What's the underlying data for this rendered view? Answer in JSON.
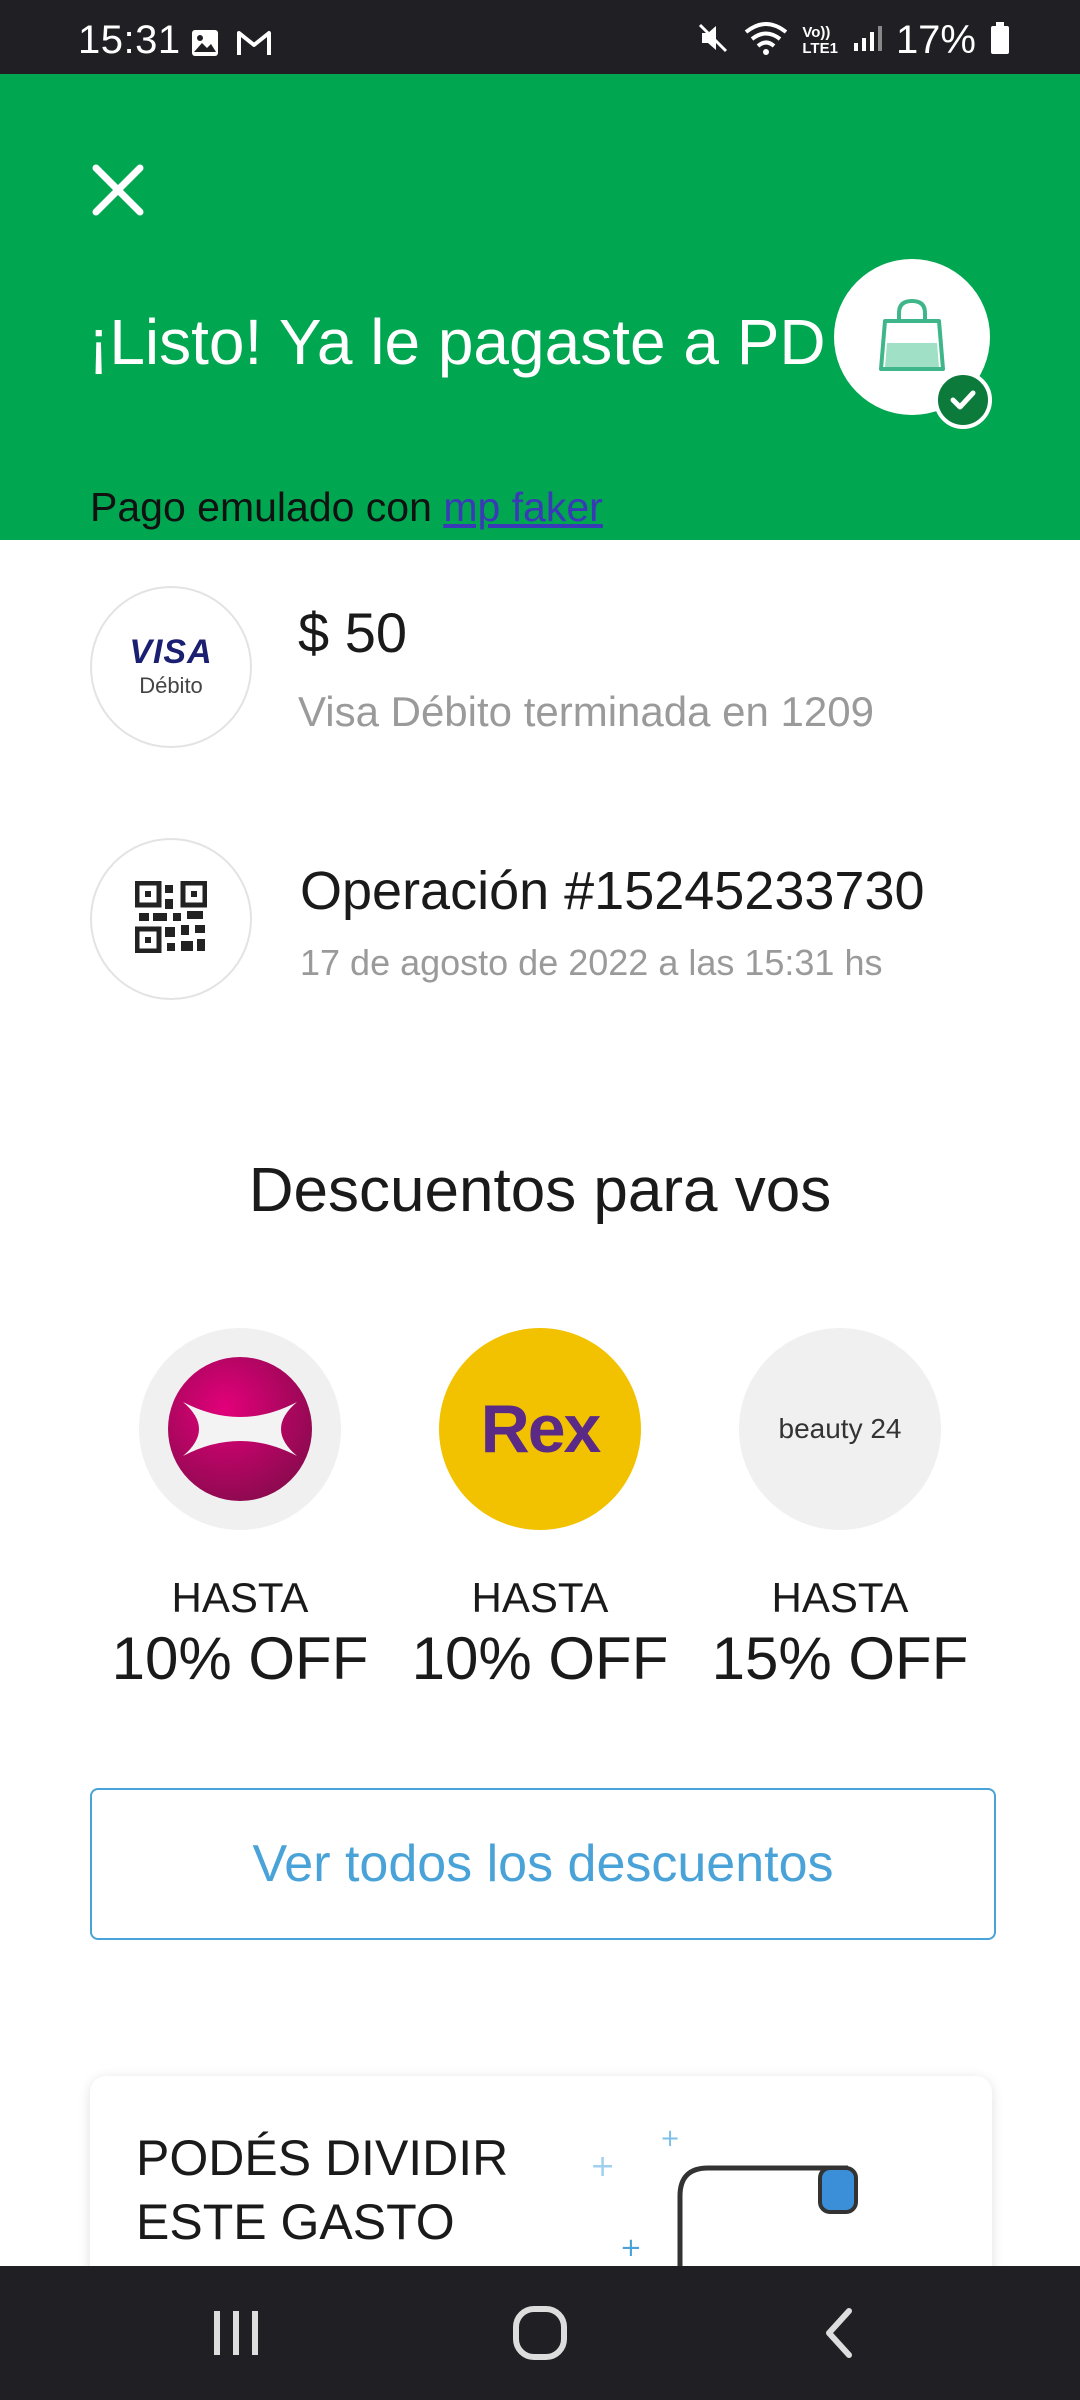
{
  "status_bar": {
    "time": "15:31",
    "battery": "17%",
    "left_icons": [
      "image-icon",
      "gmail-icon"
    ],
    "right_icons": [
      "mute-icon",
      "wifi-icon",
      "volte-icon",
      "signal-icon",
      "battery-icon"
    ],
    "volte_label_top": "Vo))",
    "volte_label_bottom": "LTE1"
  },
  "header": {
    "close_icon": "close-icon",
    "title": "¡Listo! Ya le pagaste a PD",
    "subtitle_prefix": "Pago emulado con ",
    "subtitle_link": "mp faker",
    "badge_icon": "shopping-bag-icon",
    "check_icon": "check-icon",
    "background_color": "#00a650"
  },
  "payment": {
    "card_brand": "VISA",
    "card_type": "Débito",
    "amount": "$ 50",
    "card_description": "Visa Débito terminada en 1209"
  },
  "operation": {
    "icon": "qr-code-icon",
    "title": "Operación #15245233730",
    "date": "17 de agosto de 2022 a las 15:31 hs"
  },
  "discounts": {
    "title": "Descuentos para vos",
    "items": [
      {
        "brand": "",
        "logo_icon": "x-brand-logo-icon",
        "label": "HASTA",
        "value": "10% OFF"
      },
      {
        "brand": "Rex",
        "logo_icon": "rex-logo",
        "label": "HASTA",
        "value": "10% OFF"
      },
      {
        "brand": "beauty 24",
        "logo_icon": "beauty24-logo",
        "label": "HASTA",
        "value": "15% OFF"
      }
    ],
    "see_all": "Ver todos los descuentos"
  },
  "split_card": {
    "line1": "PODÉS DIVIDIR",
    "line2": "ESTE GASTO",
    "illustration": "receipt-dollar-illustration"
  },
  "nav": {
    "recents_icon": "recents-icon",
    "home_icon": "home-icon",
    "back_icon": "back-icon"
  },
  "colors": {
    "accent_green": "#00a650",
    "link_blue": "#4aa3d8",
    "rex_yellow": "#f2c200",
    "rex_purple": "#5b2a86"
  }
}
